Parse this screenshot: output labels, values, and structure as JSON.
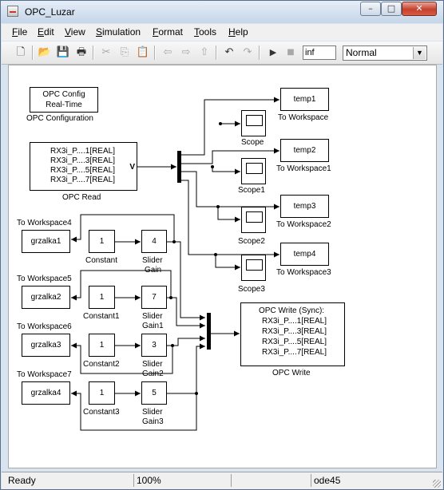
{
  "window": {
    "title": "OPC_Luzar",
    "buttons": {
      "minimize": "–",
      "maximize": "□",
      "close": "✕"
    }
  },
  "menu": [
    {
      "key": "F",
      "rest": "ile"
    },
    {
      "key": "E",
      "rest": "dit"
    },
    {
      "key": "V",
      "rest": "iew"
    },
    {
      "key": "S",
      "rest": "imulation"
    },
    {
      "key": "F",
      "rest": "ormat"
    },
    {
      "key": "T",
      "rest": "ools"
    },
    {
      "key": "H",
      "rest": "elp"
    }
  ],
  "toolbar": {
    "icons": {
      "new": "new-file-icon",
      "open": "open-folder-icon",
      "save": "save-icon",
      "print": "print-icon",
      "cut": "cut-icon",
      "copy": "copy-icon",
      "paste": "paste-icon",
      "back": "back-arrow-icon",
      "forward": "forward-arrow-icon",
      "up": "up-arrow-icon",
      "undo": "undo-icon",
      "redo": "redo-icon",
      "play": "play-icon",
      "stop": "stop-icon"
    },
    "glyphs": {
      "new": "🗋",
      "open": "📂",
      "save": "💾",
      "print": "🖶",
      "cut": "✂",
      "copy": "⎘",
      "paste": "📋",
      "back": "⇦",
      "forward": "⇨",
      "up": "⇧",
      "undo": "↶",
      "redo": "↷",
      "play": "▶",
      "stop": "■"
    },
    "stop_time": "inf",
    "sim_mode": "Normal",
    "sim_mode_arrow": "▼"
  },
  "model": {
    "opc_config": {
      "line1": "OPC Config",
      "line2": "Real-Time",
      "label": "OPC Configuration"
    },
    "opc_read": {
      "items": [
        "RX3i_P....1[REAL]",
        "RX3i_P....3[REAL]",
        "RX3i_P....5[REAL]",
        "RX3i_P....7[REAL]"
      ],
      "port": "V",
      "label": "OPC Read"
    },
    "to_workspace_top": [
      {
        "var": "temp1",
        "label": "To Workspace"
      },
      {
        "var": "temp2",
        "label": "To Workspace1"
      },
      {
        "var": "temp3",
        "label": "To Workspace2"
      },
      {
        "var": "temp4",
        "label": "To Workspace3"
      }
    ],
    "scopes": [
      {
        "label": "Scope"
      },
      {
        "label": "Scope1"
      },
      {
        "label": "Scope2"
      },
      {
        "label": "Scope3"
      }
    ],
    "heater_rows": [
      {
        "ws_title": "To Workspace4",
        "ws_var": "grzalka1",
        "const_value": "1",
        "const_label": "Constant",
        "gain_value": "4",
        "gain_label_1": "Slider",
        "gain_label_2": "Gain"
      },
      {
        "ws_title": "To Workspace5",
        "ws_var": "grzalka2",
        "const_value": "1",
        "const_label": "Constant1",
        "gain_value": "7",
        "gain_label_1": "Slider",
        "gain_label_2": "Gain1"
      },
      {
        "ws_title": "To Workspace6",
        "ws_var": "grzalka3",
        "const_value": "1",
        "const_label": "Constant2",
        "gain_value": "3",
        "gain_label_1": "Slider",
        "gain_label_2": "Gain2"
      },
      {
        "ws_title": "To Workspace7",
        "ws_var": "grzalka4",
        "const_value": "1",
        "const_label": "Constant3",
        "gain_value": "5",
        "gain_label_1": "Slider",
        "gain_label_2": "Gain3"
      }
    ],
    "opc_write": {
      "header": "OPC Write (Sync):",
      "items": [
        "RX3i_P....1[REAL]",
        "RX3i_P....3[REAL]",
        "RX3i_P....5[REAL]",
        "RX3i_P....7[REAL]"
      ],
      "label": "OPC Write"
    }
  },
  "status": {
    "state": "Ready",
    "zoom": "100%",
    "empty": "",
    "solver": "ode45"
  }
}
